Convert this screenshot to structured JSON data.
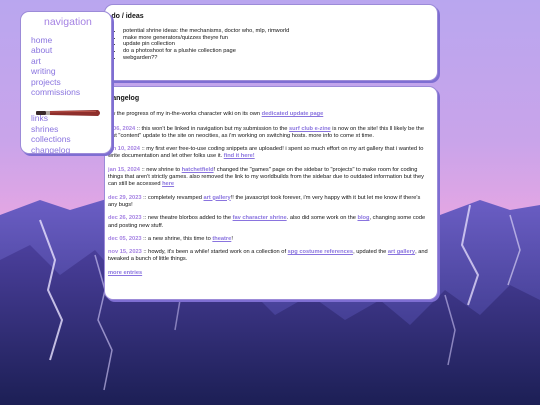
{
  "nav": {
    "title": "navigation",
    "items": [
      "home",
      "about",
      "art",
      "writing",
      "projects",
      "commissions",
      "links",
      "shrines",
      "collections",
      "changelog"
    ]
  },
  "todo": {
    "title": "-do / ideas",
    "items": [
      "potential shrine ideas: the mechanisms, doctor who, mlp, rimworld",
      "make more generators/quizzes theyre fun",
      "update pin collection",
      "do a photoshoot for a plushie collection page",
      "webgarden??"
    ]
  },
  "changelog": {
    "title": "hangelog",
    "intro_text": "ow the progress of my in-the-works character wiki on its own",
    "intro_link": "dedicated update page",
    "entries": [
      {
        "date": "b 06, 2024",
        "parts": [
          {
            "t": " :: this won't be linked in navigation but my submission to the "
          },
          {
            "l": "surf club e-zine"
          },
          {
            "t": " is now on the site! this ll likely be the last \"content\" update to the site on neocities, as i'm working on switching hosts. more info to come xt time."
          }
        ]
      },
      {
        "date": "jan 10, 2024",
        "parts": [
          {
            "t": " :: my first ever free-to-use coding snippets are uploaded! i spent so much effort on my art gallery that i wanted to write documentation and let other folks use it. "
          },
          {
            "l": "find it here!"
          }
        ]
      },
      {
        "date": "jan 15, 2024",
        "parts": [
          {
            "t": " :: new shrine to "
          },
          {
            "l": "hatchetfield"
          },
          {
            "t": "! changed the \"games\" page on the sidebar to \"projects\" to make room for coding things that aren't strictly games. also removed the link to my worldbuilds from the sidebar due to outdated information but they can still be accessed "
          },
          {
            "l": "here"
          }
        ]
      },
      {
        "date": "dec 29, 2023",
        "parts": [
          {
            "t": " :: completely revamped "
          },
          {
            "l": "art gallery"
          },
          {
            "t": "!! the javascript took forever, i'm very happy with it but let me know if there's any bugs!"
          }
        ]
      },
      {
        "date": "dec 26, 2023",
        "parts": [
          {
            "t": " :: new theatre blorbos added to the "
          },
          {
            "l": "fav character shrine"
          },
          {
            "t": ". also did some work on the "
          },
          {
            "l": "blog"
          },
          {
            "t": ", changing some code and posting new stuff."
          }
        ]
      },
      {
        "date": "dec 05, 2023",
        "parts": [
          {
            "t": " :: a new shrine, this time to "
          },
          {
            "l": "theatre"
          },
          {
            "t": "!"
          }
        ]
      },
      {
        "date": "nov 15, 2023",
        "parts": [
          {
            "t": " :: howdy, it's been a while! started work on a collection of "
          },
          {
            "l": "spg costume references"
          },
          {
            "t": ", updated the "
          },
          {
            "l": "art gallery"
          },
          {
            "t": ", and tweaked a bunch of little things."
          }
        ]
      }
    ],
    "more_label": "more entries"
  },
  "colors": {
    "accent": "#8a74df",
    "date": "#a582e3",
    "sky_top": "#b9a6ef",
    "sky_pink": "#e6a6e3"
  }
}
